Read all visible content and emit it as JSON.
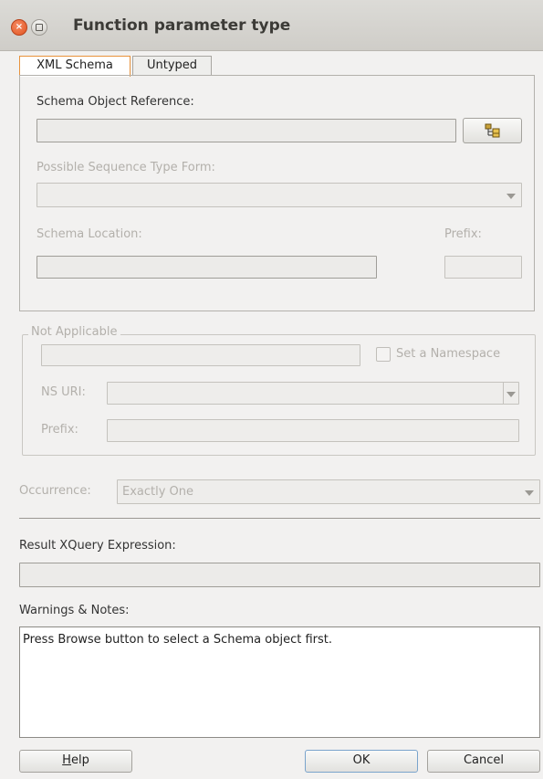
{
  "window": {
    "title": "Function parameter type",
    "close_glyph": "×"
  },
  "tabs": [
    {
      "label": "XML Schema",
      "active": true
    },
    {
      "label": "Untyped",
      "active": false
    }
  ],
  "schema": {
    "object_ref_label": "Schema Object Reference:",
    "object_ref_value": "",
    "browse_icon": "tree-browse-icon",
    "seq_type_label": "Possible Sequence Type Form:",
    "seq_type_value": "",
    "location_label": "Schema Location:",
    "location_value": "",
    "prefix_label": "Prefix:",
    "prefix_value": ""
  },
  "namespace": {
    "legend": "Not Applicable",
    "value": "",
    "set_ns_label": "Set a Namespace",
    "set_ns_checked": false,
    "ns_uri_label": "NS URI:",
    "ns_uri_value": "",
    "prefix_label": "Prefix:",
    "prefix_value": ""
  },
  "occurrence": {
    "label": "Occurrence:",
    "value": "Exactly One"
  },
  "result": {
    "label": "Result XQuery Expression:",
    "value": ""
  },
  "warnings": {
    "label": "Warnings & Notes:",
    "text": "Press Browse button to select a Schema object first."
  },
  "buttons": {
    "help_mnemonic": "H",
    "help_rest": "elp",
    "ok": "OK",
    "cancel": "Cancel"
  },
  "colors": {
    "accent_tab": "#e8923b",
    "close_button": "#e2541f",
    "default_button_border": "#7aa4cc"
  }
}
